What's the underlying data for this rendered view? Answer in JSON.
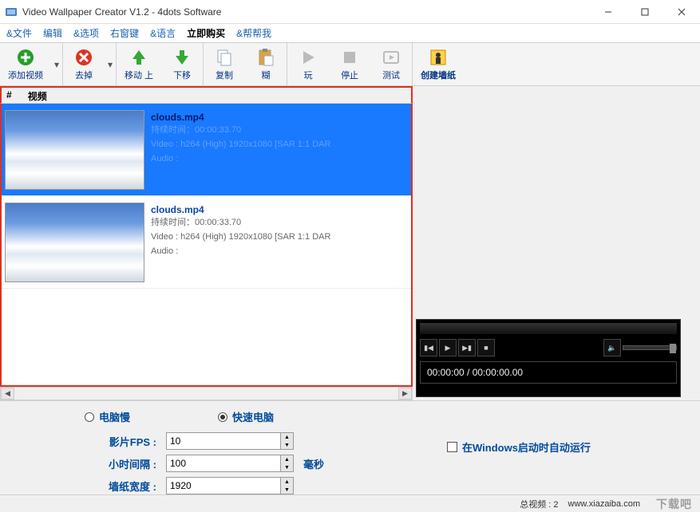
{
  "window": {
    "title": "Video Wallpaper Creator V1.2 - 4dots Software"
  },
  "menus": {
    "file": "&文件",
    "edit": "编辑",
    "options": "&选项",
    "rightkey": "右窗键",
    "language": "&语言",
    "buy": "立即购买",
    "help": "&帮帮我"
  },
  "toolbar": {
    "add": "添加视频",
    "remove": "去掉",
    "moveup": "移动 上",
    "movedown": "下移",
    "copy": "复制",
    "paste": "糊",
    "play": "玩",
    "stop": "停止",
    "test": "测试",
    "build": "创建墙纸"
  },
  "list": {
    "col_num": "#",
    "col_video": "视频",
    "rows": [
      {
        "name": "clouds.mp4",
        "duration": "持续时间：00:00:33.70",
        "video": "Video : h264 (High) 1920x1080 [SAR 1:1 DAR",
        "audio": "Audio :"
      },
      {
        "name": "clouds.mp4",
        "duration": "持续时间：00:00:33.70",
        "video": "Video : h264 (High) 1920x1080 [SAR 1:1 DAR",
        "audio": "Audio :"
      }
    ]
  },
  "player": {
    "time": "00:00:00 / 00:00:00.00"
  },
  "options": {
    "slow_pc": "电脑慢",
    "fast_pc": "快速电脑",
    "fps_label": "影片FPS :",
    "fps_value": "10",
    "interval_label": "小时间隔 :",
    "interval_value": "100",
    "interval_unit": "毫秒",
    "width_label": "墙纸宽度 :",
    "width_value": "1920",
    "autorun": "在Windows启动时自动运行"
  },
  "status": {
    "total": "总视频 : 2",
    "site": "www.xiazaiba.com",
    "wm": "下载吧"
  }
}
